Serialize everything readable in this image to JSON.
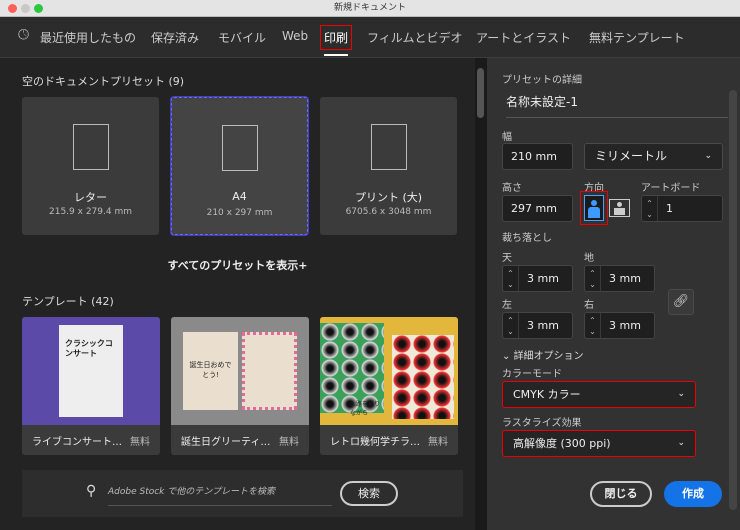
{
  "window": {
    "title": "新規ドキュメント"
  },
  "tabs": [
    {
      "label": "最近使用したもの"
    },
    {
      "label": "保存済み"
    },
    {
      "label": "モバイル"
    },
    {
      "label": "Web"
    },
    {
      "label": "印刷"
    },
    {
      "label": "フィルムとビデオ"
    },
    {
      "label": "アートとイラスト"
    },
    {
      "label": "無料テンプレート"
    }
  ],
  "presets": {
    "heading": "空のドキュメントプリセット",
    "count": "(9)",
    "items": [
      {
        "name": "レター",
        "size": "215.9 x 279.4 mm"
      },
      {
        "name": "A4",
        "size": "210 x 297 mm"
      },
      {
        "name": "プリント (大)",
        "size": "6705.6 x 3048 mm"
      }
    ],
    "show_all": "すべてのプリセットを表示+"
  },
  "templates": {
    "heading": "テンプレート",
    "count": "(42)",
    "items": [
      {
        "name": "ライブコンサート…",
        "price": "無料"
      },
      {
        "name": "誕生日グリーティ…",
        "price": "無料"
      },
      {
        "name": "レトロ幾何学チラ…",
        "price": "無料"
      }
    ],
    "thumb_text": [
      "クラシックコンサート",
      "誕生日おめでとう!",
      "山路を登りながら"
    ]
  },
  "search": {
    "placeholder": "Adobe Stock で他のテンプレートを検索",
    "button": "検索"
  },
  "details": {
    "heading": "プリセットの詳細",
    "name": "名称未設定-1",
    "width_label": "幅",
    "width": "210 mm",
    "unit": "ミリメートル",
    "height_label": "高さ",
    "height": "297 mm",
    "orientation_label": "方向",
    "artboard_label": "アートボード",
    "artboards": "1",
    "bleed_label": "裁ち落とし",
    "top_label": "天",
    "top": "3 mm",
    "bottom_label": "地",
    "bottom": "3 mm",
    "left_label": "左",
    "left": "3 mm",
    "right_label": "右",
    "right": "3 mm",
    "advanced": "詳細オプション",
    "color_mode_label": "カラーモード",
    "color_mode": "CMYK カラー",
    "raster_label": "ラスタライズ効果",
    "raster": "高解像度 (300 ppi)"
  },
  "buttons": {
    "close": "閉じる",
    "create": "作成"
  },
  "colors": {
    "accent": "#1473e6",
    "highlight": "#e00000"
  }
}
